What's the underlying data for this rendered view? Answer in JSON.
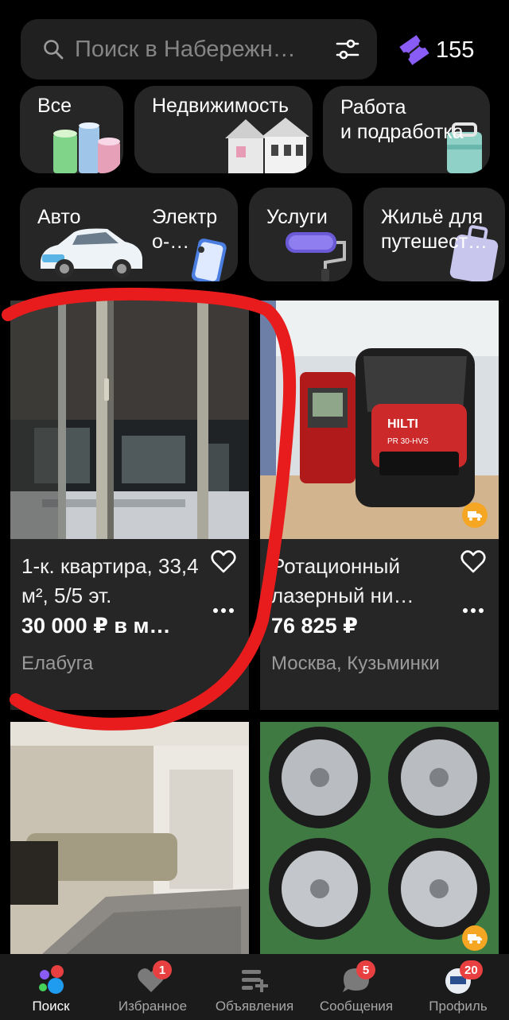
{
  "search": {
    "placeholder": "Поиск в Набережн…",
    "promo_count": "155"
  },
  "categories": [
    {
      "label": "Все"
    },
    {
      "label": "Недвижимость"
    },
    {
      "label": "Работа\nи подработка"
    },
    {
      "label": "Авто"
    },
    {
      "label": "Электр\nо-…"
    },
    {
      "label": "Услуги"
    },
    {
      "label": "Жильё для\nпутешест…"
    }
  ],
  "listings": [
    {
      "title": "1-к. квартира, 33,4 м², 5/5 эт.",
      "price": "30 000 ₽ в м…",
      "location": "Елабуга",
      "delivery": false
    },
    {
      "title": "Ротационный лазерный ни…",
      "price": "76 825 ₽",
      "location": "Москва, Кузьминки",
      "delivery": true,
      "brand": "HILTI",
      "model": "PR 30-HVS"
    },
    {
      "title": "",
      "price": "",
      "location": "",
      "delivery": false
    },
    {
      "title": "",
      "price": "",
      "location": "",
      "delivery": true
    }
  ],
  "nav": {
    "search": "Поиск",
    "favorites": "Избранное",
    "favorites_badge": "1",
    "ads": "Объявления",
    "messages": "Сообщения",
    "messages_badge": "5",
    "profile": "Профиль",
    "profile_badge": "20"
  },
  "colors": {
    "background": "#000000",
    "surface": "#262626",
    "accent_purple": "#8a5cf6",
    "badge_red": "#e84040",
    "delivery_orange": "#f5a623",
    "annotation_red": "#e81c1c"
  }
}
